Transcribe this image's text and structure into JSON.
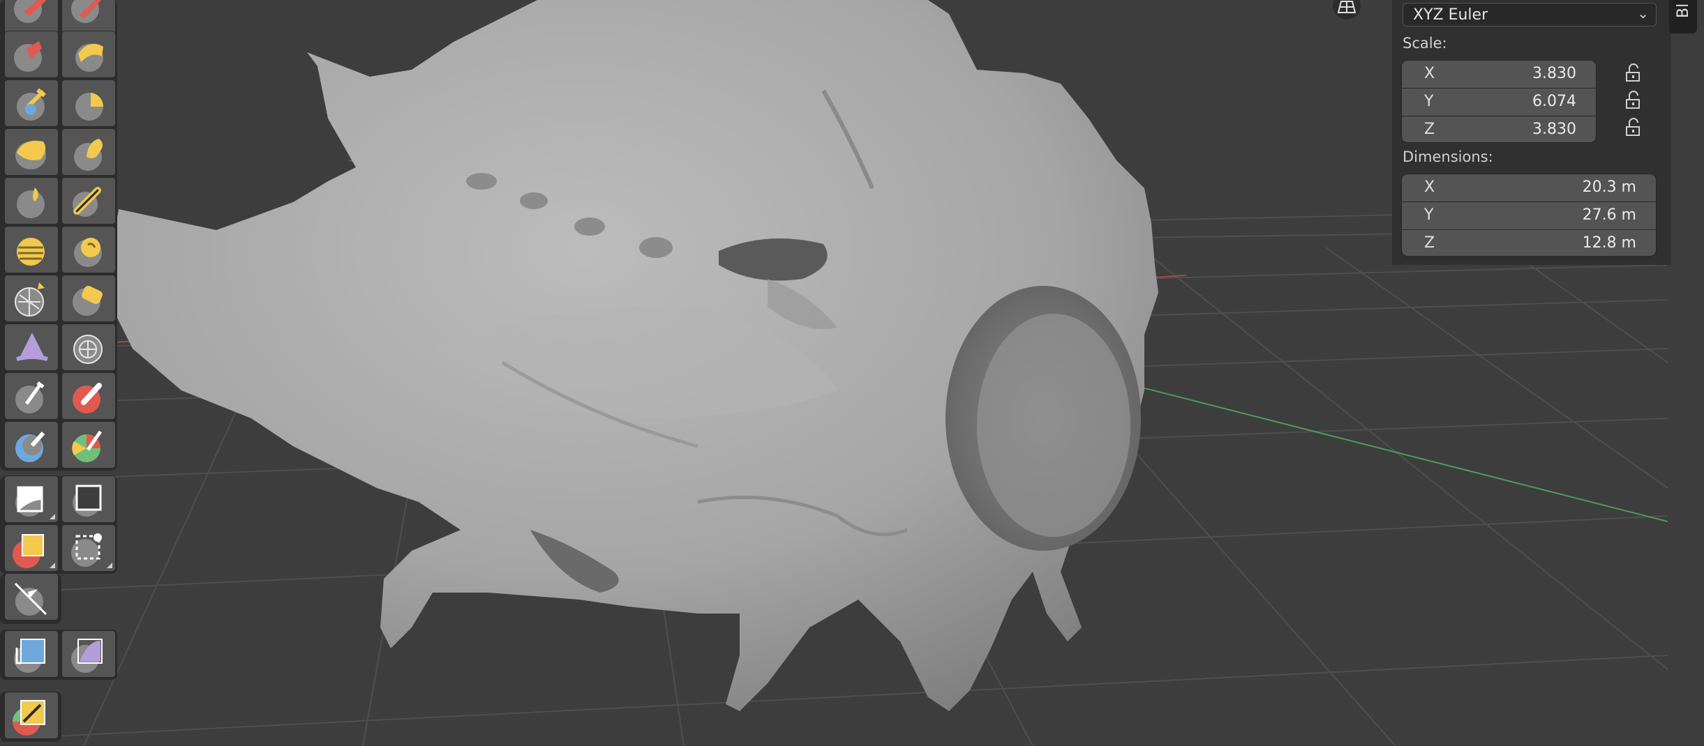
{
  "viewport": {
    "axis_colors": {
      "x_axis": "#a04848",
      "y_axis": "#4f9a5a"
    },
    "grid_color": "#4f4f4f",
    "background": "#3d3d3d",
    "mesh_color": "#a8a8a8"
  },
  "toolbar": {
    "group1": [
      {
        "name": "draw-icon"
      },
      {
        "name": "draw-sharp-icon"
      },
      {
        "name": "clay-icon"
      },
      {
        "name": "clay-strips-icon"
      },
      {
        "name": "clay-thumb-icon"
      },
      {
        "name": "layer-icon"
      },
      {
        "name": "inflate-icon"
      },
      {
        "name": "blob-icon"
      },
      {
        "name": "crease-icon"
      },
      {
        "name": "smooth-icon"
      },
      {
        "name": "flatten-icon"
      },
      {
        "name": "fill-icon"
      },
      {
        "name": "scrape-icon"
      },
      {
        "name": "multiplane-scrape-icon"
      },
      {
        "name": "pinch-icon"
      },
      {
        "name": "grab-icon"
      },
      {
        "name": "elastic-deform-icon"
      },
      {
        "name": "snake-hook-icon"
      },
      {
        "name": "thumb-icon"
      },
      {
        "name": "pose-icon"
      }
    ],
    "group2": [
      {
        "name": "box-mask-icon"
      },
      {
        "name": "box-hide-icon"
      },
      {
        "name": "box-face-set-icon"
      },
      {
        "name": "box-trim-icon"
      },
      {
        "name": "line-project-icon"
      }
    ],
    "group3": [
      {
        "name": "mesh-filter-icon"
      },
      {
        "name": "cloth-filter-icon"
      }
    ],
    "group4": [
      {
        "name": "annotate-icon"
      }
    ]
  },
  "header": {
    "viewport_icon": "grid-perspective-icon"
  },
  "sidebar_tab": {
    "label": "Bl"
  },
  "transform": {
    "rotation_mode": "XYZ Euler",
    "scale": {
      "label": "Scale:",
      "fields": [
        {
          "axis": "X",
          "value": "3.830"
        },
        {
          "axis": "Y",
          "value": "6.074"
        },
        {
          "axis": "Z",
          "value": "3.830"
        }
      ]
    },
    "dimensions": {
      "label": "Dimensions:",
      "fields": [
        {
          "axis": "X",
          "value": "20.3 m"
        },
        {
          "axis": "Y",
          "value": "27.6 m"
        },
        {
          "axis": "Z",
          "value": "12.8 m"
        }
      ]
    }
  }
}
